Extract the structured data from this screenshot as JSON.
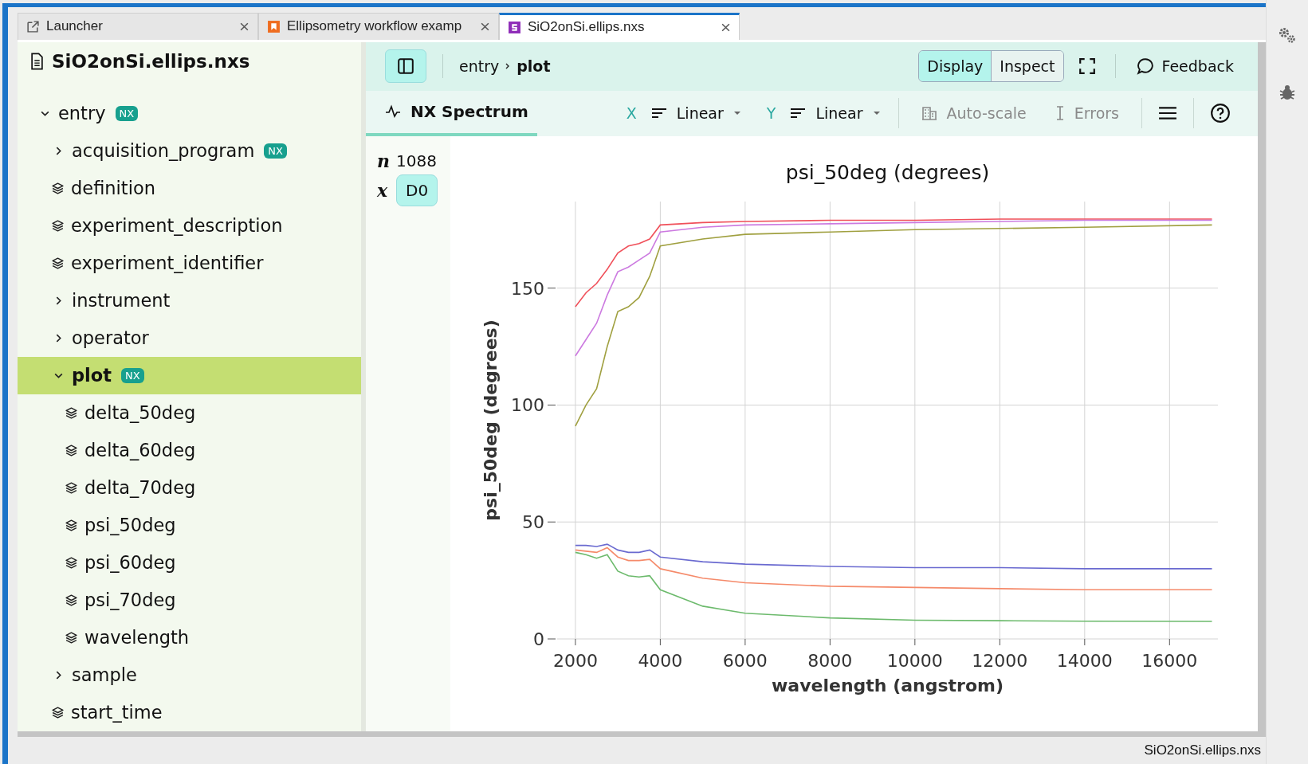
{
  "tabs": [
    {
      "label": "Launcher",
      "kind": "launcher",
      "selected": false
    },
    {
      "label": "Ellipsometry workflow examp",
      "kind": "notebook",
      "selected": false
    },
    {
      "label": "SiO2onSi.ellips.nxs",
      "kind": "nexus",
      "selected": true
    }
  ],
  "tree": {
    "file": "SiO2onSi.ellips.nxs",
    "items": [
      {
        "label": "entry",
        "kind": "group",
        "badge": "NX",
        "expanded": true,
        "selected": false,
        "children": [
          {
            "label": "acquisition_program",
            "kind": "group",
            "badge": "NX",
            "expanded": false,
            "selected": false
          },
          {
            "label": "definition",
            "kind": "dataset",
            "selected": false
          },
          {
            "label": "experiment_description",
            "kind": "dataset",
            "selected": false
          },
          {
            "label": "experiment_identifier",
            "kind": "dataset",
            "selected": false
          },
          {
            "label": "instrument",
            "kind": "group",
            "expanded": false,
            "selected": false
          },
          {
            "label": "operator",
            "kind": "group",
            "expanded": false,
            "selected": false
          },
          {
            "label": "plot",
            "kind": "group",
            "badge": "NX",
            "expanded": true,
            "selected": true,
            "children": [
              {
                "label": "delta_50deg",
                "kind": "dataset",
                "selected": false
              },
              {
                "label": "delta_60deg",
                "kind": "dataset",
                "selected": false
              },
              {
                "label": "delta_70deg",
                "kind": "dataset",
                "selected": false
              },
              {
                "label": "psi_50deg",
                "kind": "dataset",
                "selected": false
              },
              {
                "label": "psi_60deg",
                "kind": "dataset",
                "selected": false
              },
              {
                "label": "psi_70deg",
                "kind": "dataset",
                "selected": false
              },
              {
                "label": "wavelength",
                "kind": "dataset",
                "selected": false
              }
            ]
          },
          {
            "label": "sample",
            "kind": "group",
            "expanded": false,
            "selected": false
          },
          {
            "label": "start_time",
            "kind": "dataset",
            "selected": false
          }
        ]
      }
    ]
  },
  "header": {
    "breadcrumb": [
      "entry",
      "plot"
    ],
    "view_modes": [
      {
        "label": "Display",
        "selected": true
      },
      {
        "label": "Inspect",
        "selected": false
      }
    ],
    "feedback": "Feedback"
  },
  "toolbar": {
    "visualization": "NX Spectrum",
    "x_axis": {
      "label": "X",
      "scale": "Linear"
    },
    "y_axis": {
      "label": "Y",
      "scale": "Linear"
    },
    "toggles": [
      {
        "label": "Auto-scale",
        "kind": "autoscale",
        "disabled": true
      },
      {
        "label": "Errors",
        "kind": "errors",
        "disabled": true
      }
    ]
  },
  "dims": {
    "n_label": "n",
    "n_value": "1088",
    "x_label": "x",
    "x_value": "D0"
  },
  "chart_data": {
    "type": "line",
    "title": "psi_50deg (degrees)",
    "xlabel": "wavelength (angstrom)",
    "ylabel": "psi_50deg (degrees)",
    "x": [
      2000,
      2250,
      2500,
      2750,
      3000,
      3250,
      3500,
      3750,
      4000,
      5000,
      6000,
      8000,
      10000,
      12000,
      14000,
      17000
    ],
    "series": [
      {
        "color": "#f0505a",
        "values": [
          142,
          148,
          152,
          158,
          165,
          168,
          169,
          171,
          177,
          178,
          178.5,
          179,
          179,
          179.5,
          179.5,
          179.5
        ]
      },
      {
        "color": "#cc7ae0",
        "values": [
          121,
          128,
          135,
          147,
          157,
          159,
          162,
          165,
          174,
          176,
          177,
          177.5,
          178,
          178.5,
          179,
          179
        ]
      },
      {
        "color": "#a0a040",
        "values": [
          91,
          100,
          107,
          125,
          140,
          142,
          146,
          155,
          168,
          171,
          173,
          174,
          175,
          175.5,
          176,
          177
        ]
      },
      {
        "color": "#6a6ad0",
        "values": [
          40,
          40,
          39.5,
          40.5,
          38,
          37,
          37,
          38,
          35,
          33,
          32,
          31,
          30.5,
          30.5,
          30,
          30
        ]
      },
      {
        "color": "#f58a6a",
        "values": [
          38,
          37.5,
          37,
          39,
          35,
          33.5,
          33.5,
          34,
          30,
          26,
          24,
          22.5,
          22,
          21.5,
          21,
          21
        ]
      },
      {
        "color": "#6cba6c",
        "values": [
          37,
          36,
          34.5,
          36,
          29,
          27,
          26.5,
          27,
          21,
          14,
          11,
          9,
          8,
          7.8,
          7.6,
          7.5
        ]
      }
    ],
    "grid": true,
    "xlim": [
      1570,
      17140
    ],
    "ylim": [
      0,
      187
    ],
    "xticks": [
      2000,
      4000,
      6000,
      8000,
      10000,
      12000,
      14000,
      16000
    ],
    "yticks": [
      0,
      50,
      100,
      150
    ]
  },
  "status_bar": "SiO2onSi.ellips.nxs"
}
